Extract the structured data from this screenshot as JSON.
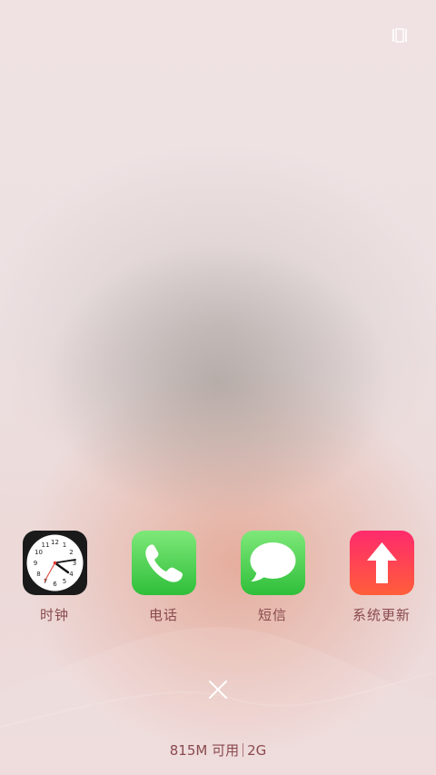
{
  "recents": {
    "icon": "recents-icon"
  },
  "apps": [
    {
      "label": "时钟",
      "icon": "clock-icon"
    },
    {
      "label": "电话",
      "icon": "phone-icon"
    },
    {
      "label": "短信",
      "icon": "message-icon"
    },
    {
      "label": "系统更新",
      "icon": "update-arrow-icon"
    }
  ],
  "clock": {
    "numbers": [
      "12",
      "1",
      "2",
      "3",
      "4",
      "5",
      "6",
      "7",
      "8",
      "9",
      "10",
      "11"
    ]
  },
  "close": {
    "icon": "close-icon"
  },
  "memory": {
    "available": "815M 可用",
    "total": "2G"
  },
  "colors": {
    "label": "#8a4a4e",
    "update_top": "#ff2a6d",
    "update_bottom": "#ff5e3a",
    "green_top": "#7ee879",
    "green_bottom": "#2fbf3a"
  }
}
